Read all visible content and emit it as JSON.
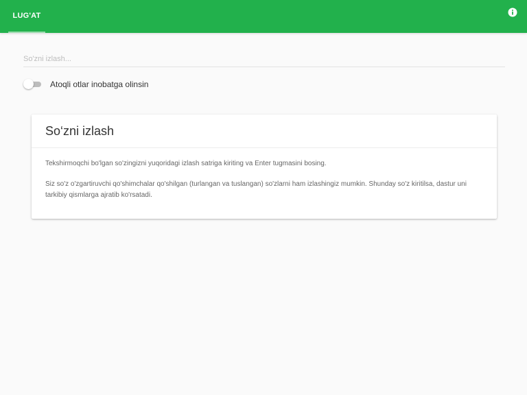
{
  "header": {
    "tab_label": "LUG'AT",
    "info_icon": "info-icon",
    "bar_color": "#22b14c"
  },
  "search": {
    "placeholder": "So'zni izlash...",
    "value": ""
  },
  "toggle": {
    "label": "Atoqli otlar inobatga olinsin",
    "checked": false
  },
  "card": {
    "title": "So‘zni izlash",
    "paragraph1": "Tekshirmoqchi bo'lgan so'zingizni yuqoridagi izlash satriga kiriting va Enter tugmasini bosing.",
    "paragraph2": "Siz so'z o'zgartiruvchi qo'shimchalar qo'shilgan (turlangan va tuslangan) so'zlarni ham izlashingiz mumkin. Shunday so'z kiritilsa, dastur uni tarkibiy qismlarga ajratib ko'rsatadi."
  }
}
